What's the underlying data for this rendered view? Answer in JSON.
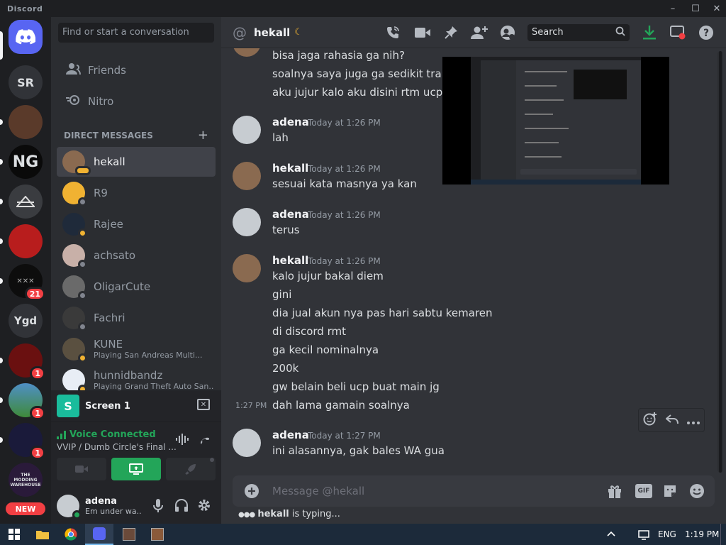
{
  "window": {
    "title": "Discord",
    "minimize": "–",
    "maximize": "☐",
    "close": "✕"
  },
  "rail": {
    "servers": [
      {
        "label": "SR"
      },
      {
        "label": "NG"
      },
      {
        "label": "21"
      },
      {
        "label": "Ygd"
      },
      {
        "label": "1"
      },
      {
        "label": "1"
      },
      {
        "label": "1"
      },
      {
        "label": "THE MODDING WAREHOUSE"
      },
      {
        "label": "NEW"
      }
    ]
  },
  "sidebar": {
    "search_placeholder": "Find or start a conversation",
    "friends": "Friends",
    "nitro": "Nitro",
    "dm_header": "DIRECT MESSAGES",
    "dm_add": "+",
    "dms": [
      {
        "name": "hekall",
        "status_color": "#f0b232"
      },
      {
        "name": "R9",
        "status_color": "#80848e"
      },
      {
        "name": "Rajee",
        "status_color": "#f0b232"
      },
      {
        "name": "achsato",
        "status_color": "#80848e"
      },
      {
        "name": "OligarCute",
        "status_color": "#80848e"
      },
      {
        "name": "Fachri",
        "status_color": "#80848e"
      },
      {
        "name": "KUNE",
        "sub": "Playing San Andreas Multi...",
        "status_color": "#f0b232"
      },
      {
        "name": "hunnidbandz",
        "sub": "Playing Grand Theft Auto San...",
        "status_color": "#f0b232"
      }
    ]
  },
  "screen": {
    "label": "Screen 1",
    "icon": "S"
  },
  "voice": {
    "status": "Voice Connected",
    "channel": "VVIP / Dumb Circle's Final ..."
  },
  "user": {
    "name": "adena",
    "status": "Em under wa..."
  },
  "header": {
    "at": "@",
    "name": "hekall",
    "search_label": "Search"
  },
  "messages": {
    "top_lines": [
      "bisa jaga rahasia ga nih?",
      "soalnya saya juga ga sedikit transak",
      "aku jujur kalo aku disini rtm ucp san"
    ],
    "groups": [
      {
        "author": "adena",
        "time": "Today at 1:26 PM",
        "lines": [
          "lah"
        ]
      },
      {
        "author": "hekall",
        "time": "Today at 1:26 PM",
        "lines": [
          "sesuai kata masnya ya kan"
        ]
      },
      {
        "author": "adena",
        "time": "Today at 1:26 PM",
        "lines": [
          "terus"
        ]
      },
      {
        "author": "hekall",
        "time": "Today at 1:26 PM",
        "lines": [
          "kalo jujur bakal diem",
          "gini",
          "dia jual akun nya pas hari sabtu kemaren",
          "di discord rmt",
          "ga kecil nominalnya",
          "200k",
          "gw belain beli ucp buat main jg"
        ]
      },
      {
        "author": "adena",
        "time": "Today at 1:27 PM",
        "lines": [
          "ini alasannya, gak bales WA gua"
        ]
      }
    ],
    "standalone": {
      "time": "1:27 PM",
      "text": "dah lama gamain soalnya"
    }
  },
  "composer": {
    "placeholder": "Message @hekall",
    "gif": "GIF"
  },
  "typing": {
    "name": "hekall",
    "text": " is typing..."
  },
  "taskbar": {
    "lang": "ENG",
    "time": "1:19 PM"
  },
  "colors": {
    "accent": "#5865f2",
    "green": "#23a559",
    "red": "#f23f43"
  }
}
